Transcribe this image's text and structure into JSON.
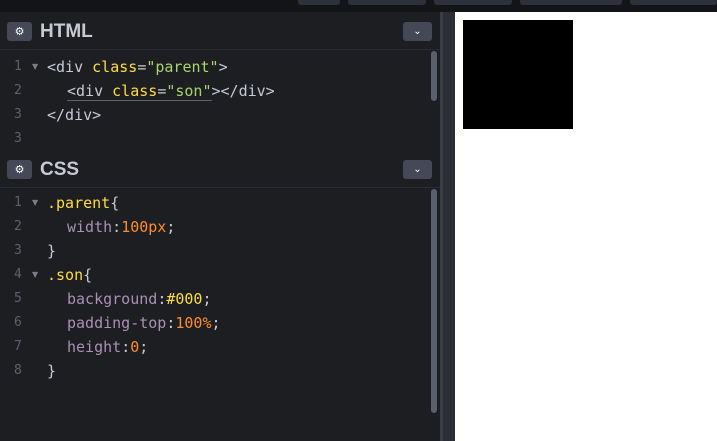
{
  "html_panel": {
    "title": "HTML",
    "gear_icon": "⚙",
    "collapse_icon": "⌄",
    "line_numbers": [
      "1",
      "2",
      "3"
    ],
    "lines": {
      "l1": {
        "open": "<div ",
        "attr": "class",
        "eq": "=",
        "str": "\"parent\"",
        "close": ">"
      },
      "l2": {
        "open": "<div ",
        "attr": "class",
        "eq": "=",
        "str": "\"son\"",
        "close": "></div>"
      },
      "l3": {
        "text": "</div>"
      }
    }
  },
  "css_panel": {
    "title": "CSS",
    "gear_icon": "⚙",
    "collapse_icon": "⌄",
    "line_numbers": [
      "1",
      "2",
      "3",
      "4",
      "5",
      "6",
      "7",
      "8"
    ],
    "lines": {
      "l1": {
        "selector": ".parent",
        "brace": "{"
      },
      "l2": {
        "prop": "width",
        "colon": ":",
        "value": "100px",
        "semi": ";"
      },
      "l3": {
        "brace": "}"
      },
      "l4": {
        "selector": ".son",
        "brace": "{"
      },
      "l5": {
        "prop": "background",
        "colon": ":",
        "value": "#000",
        "semi": ";"
      },
      "l6": {
        "prop": "padding-top",
        "colon": ":",
        "value": "100%",
        "semi": ";"
      },
      "l7": {
        "prop": "height",
        "colon": ":",
        "value": "0",
        "semi": ";"
      },
      "l8": {
        "brace": "}"
      }
    }
  },
  "preview": {
    "son_background": "#000000",
    "page_background": "#ffffff"
  },
  "colors": {
    "editor_bg": "#1d1e22",
    "attr": "#ffdd40",
    "string": "#a8d66a",
    "property": "#aa8fb6",
    "number": "#ff8c28"
  }
}
